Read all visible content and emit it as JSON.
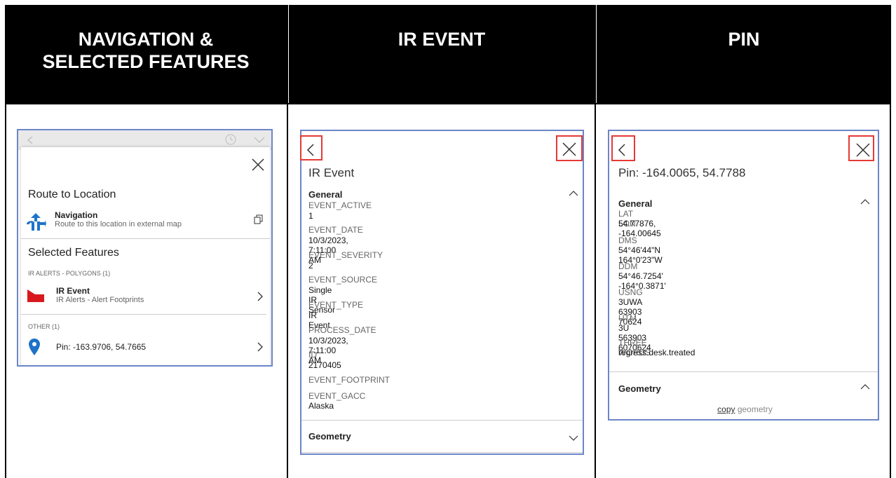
{
  "headers": [
    "NAVIGATION &\nSELECTED FEATURES",
    "IR EVENT",
    "PIN"
  ],
  "nav": {
    "route_title": "Route to Location",
    "nav_title": "Navigation",
    "nav_sub": "Route to this location in external map",
    "selected_title": "Selected Features",
    "group1": "IR ALERTS - POLYGONS (1)",
    "item1_title": "IR Event",
    "item1_sub": "IR Alerts - Alert Footprints",
    "group2": "OTHER (1)",
    "item2_title": "Pin: -163.9706, 54.7665"
  },
  "ir": {
    "title": "IR Event",
    "section": "General",
    "fields": [
      {
        "label": "EVENT_ACTIVE",
        "value": "1"
      },
      {
        "label": "EVENT_DATE",
        "value": "10/3/2023, 7:11:00 AM"
      },
      {
        "label": "EVENT_SEVERITY",
        "value": "2"
      },
      {
        "label": "EVENT_SOURCE",
        "value": "Single IR Sensor"
      },
      {
        "label": "EVENT_TYPE",
        "value": "IR Event"
      },
      {
        "label": "PROCESS_DATE",
        "value": "10/3/2023, 7:11:00 AM"
      },
      {
        "label": "ID",
        "value": "2170405"
      },
      {
        "label": "EVENT_FOOTPRINT",
        "value": ""
      },
      {
        "label": "EVENT_GACC",
        "value": "Alaska"
      }
    ],
    "geometry": "Geometry"
  },
  "pin": {
    "title": "Pin: -164.0065, 54.7788",
    "section": "General",
    "fields": [
      {
        "label": "LAT LON",
        "value": "54.77876, -164.00645"
      },
      {
        "label": "DMS",
        "value": "54°46'44\"N 164°0'23\"W"
      },
      {
        "label": "DDM",
        "value": "54°46.7254' -164°0.3871'"
      },
      {
        "label": "USNG",
        "value": "3UWA 63903 70624"
      },
      {
        "label": "UTM",
        "value": "3U 563903 6070624"
      },
      {
        "label": "THREE WORDS",
        "value": "regress.desk.treated"
      }
    ],
    "geometry": "Geometry",
    "copy_link": "copy",
    "copy_rest": " geometry"
  }
}
